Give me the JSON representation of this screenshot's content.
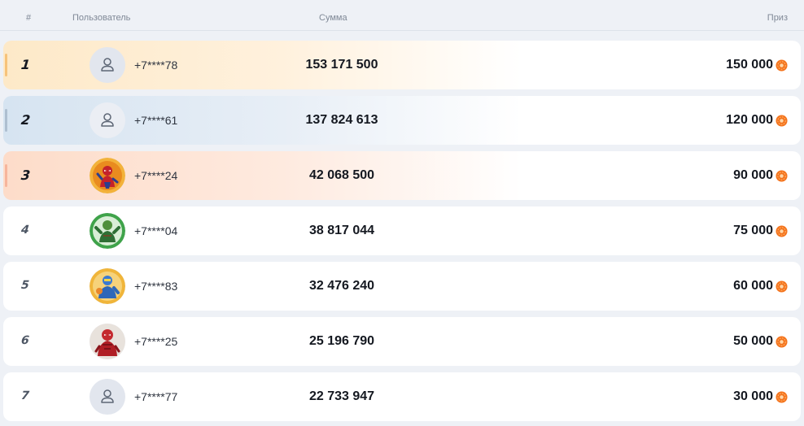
{
  "header": {
    "rank": "#",
    "user": "Пользователь",
    "sum": "Сумма",
    "prize": "Приз"
  },
  "rows": [
    {
      "rank": "1",
      "phone": "+7****78",
      "sum": "153 171 500",
      "prize": "150 000",
      "avatar": "default-user-icon"
    },
    {
      "rank": "2",
      "phone": "+7****61",
      "sum": "137 824 613",
      "prize": "120 000",
      "avatar": "default-user-icon"
    },
    {
      "rank": "3",
      "phone": "+7****24",
      "sum": "42 068 500",
      "prize": "90 000",
      "avatar": "hero-avatar-red"
    },
    {
      "rank": "4",
      "phone": "+7****04",
      "sum": "38 817 044",
      "prize": "75 000",
      "avatar": "hero-avatar-green"
    },
    {
      "rank": "5",
      "phone": "+7****83",
      "sum": "32 476 240",
      "prize": "60 000",
      "avatar": "hero-avatar-blue"
    },
    {
      "rank": "6",
      "phone": "+7****25",
      "sum": "25 196 790",
      "prize": "50 000",
      "avatar": "hero-avatar-crimson"
    },
    {
      "rank": "7",
      "phone": "+7****77",
      "sum": "22 733 947",
      "prize": "30 000",
      "avatar": "default-user-icon"
    }
  ],
  "colors": {
    "coin": "#f4731c",
    "gold": "#fde9c8",
    "silver": "#d6e4f1",
    "bronze": "#fddcc9"
  }
}
